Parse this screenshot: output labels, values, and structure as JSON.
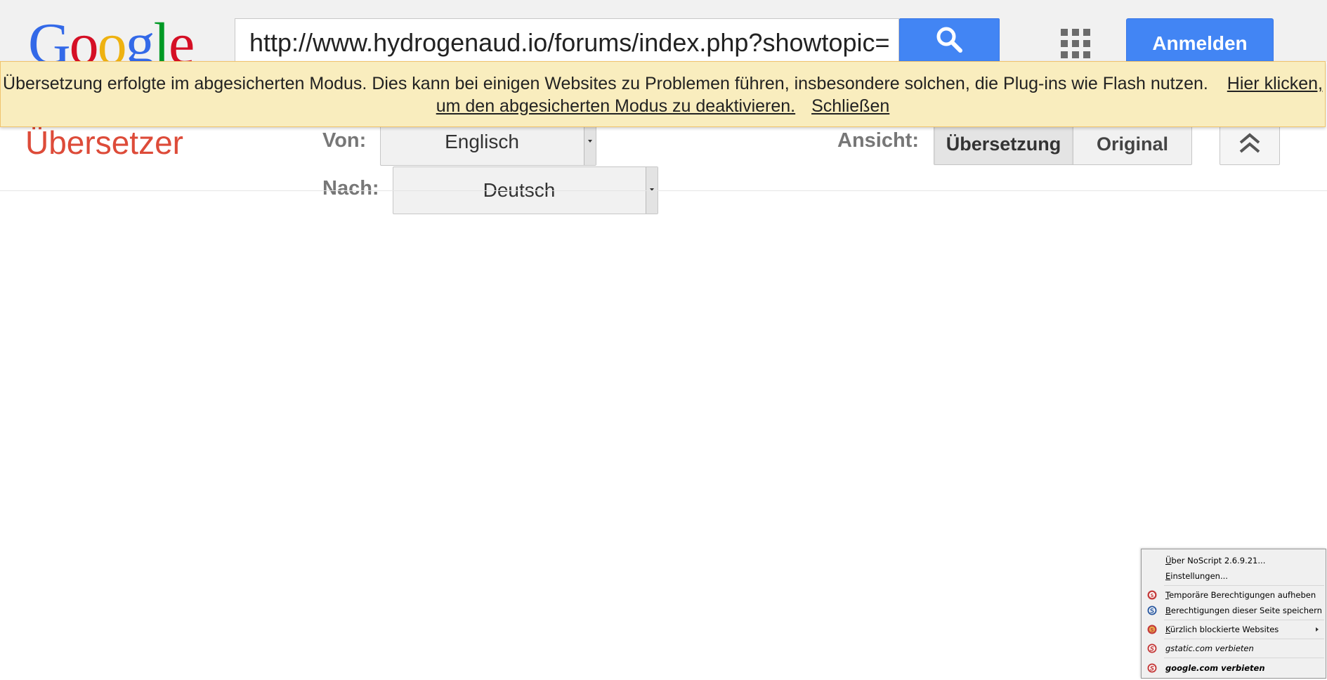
{
  "header": {
    "logo_letters": [
      {
        "ch": "G",
        "color": "#3369e8"
      },
      {
        "ch": "o",
        "color": "#d50f25"
      },
      {
        "ch": "o",
        "color": "#eeb211"
      },
      {
        "ch": "g",
        "color": "#3369e8"
      },
      {
        "ch": "l",
        "color": "#009925"
      },
      {
        "ch": "e",
        "color": "#d50f25"
      }
    ],
    "url_value": "http://www.hydrogenaud.io/forums/index.php?showtopic=",
    "search_icon": "search-icon",
    "apps_icon": "apps-grid-icon",
    "signin_label": "Anmelden"
  },
  "infobar": {
    "message": "Übersetzung erfolgte im abgesicherten Modus. Dies kann bei einigen Websites zu Problemen führen, insbesondere solchen, die Plug-ins wie Flash nutzen.",
    "link_disable": "Hier klicken, um den abgesicherten Modus zu deaktivieren.",
    "link_close": "Schließen"
  },
  "translator": {
    "title": "Übersetzer",
    "from_label": "Von:",
    "from_value": "Englisch",
    "to_label": "Nach:",
    "to_value": "Deutsch",
    "view_label": "Ansicht:",
    "view_translation": "Übersetzung",
    "view_original": "Original",
    "collapse_icon": "double-chevron-up-icon"
  },
  "noscript_menu": {
    "items": [
      {
        "label": "Über NoScript 2.6.9.21...",
        "underline": "Ü",
        "icon": ""
      },
      {
        "label": "Einstellungen...",
        "underline": "E",
        "icon": ""
      },
      {
        "label": "Temporäre Berechtigungen aufheben",
        "underline": "T",
        "icon": "noscript-revoke-icon"
      },
      {
        "label": "Berechtigungen dieser Seite speichern",
        "underline": "B",
        "icon": "noscript-save-icon"
      },
      {
        "label": "Kürzlich blockierte Websites",
        "underline": "K",
        "icon": "noscript-recent-icon"
      },
      {
        "label": "gstatic.com verbieten",
        "icon": "noscript-forbid-icon"
      },
      {
        "label": "google.com verbieten",
        "icon": "noscript-forbid-icon"
      }
    ]
  },
  "colors": {
    "accent_blue": "#4285f4",
    "title_red": "#dd4b39",
    "infobar_bg": "#f9edbe"
  }
}
